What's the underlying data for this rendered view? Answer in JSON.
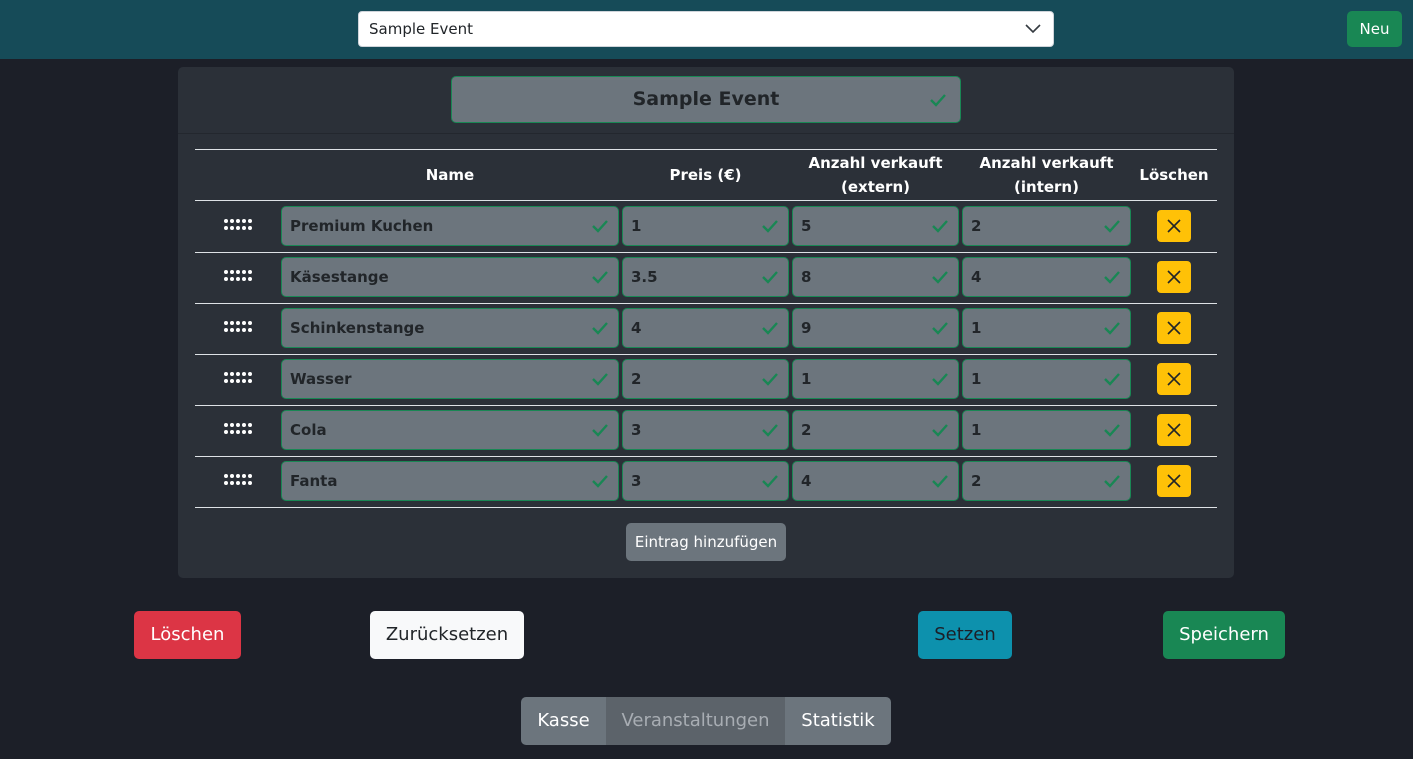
{
  "header": {
    "selected_event": "Sample Event",
    "new_button": "Neu"
  },
  "event": {
    "name": "Sample Event"
  },
  "table": {
    "columns": {
      "name": "Name",
      "price": "Preis (€)",
      "sold_external_1": "Anzahl verkauft",
      "sold_external_2": "(extern)",
      "sold_internal_1": "Anzahl verkauft",
      "sold_internal_2": "(intern)",
      "delete": "Löschen"
    },
    "rows": [
      {
        "name": "Premium Kuchen",
        "price": "1",
        "external": "5",
        "internal": "2"
      },
      {
        "name": "Käsestange",
        "price": "3.5",
        "external": "8",
        "internal": "4"
      },
      {
        "name": "Schinkenstange",
        "price": "4",
        "external": "9",
        "internal": "1"
      },
      {
        "name": "Wasser",
        "price": "2",
        "external": "1",
        "internal": "1"
      },
      {
        "name": "Cola",
        "price": "3",
        "external": "2",
        "internal": "1"
      },
      {
        "name": "Fanta",
        "price": "3",
        "external": "4",
        "internal": "2"
      }
    ],
    "add_entry": "Eintrag hinzufügen"
  },
  "actions": {
    "delete": "Löschen",
    "reset": "Zurücksetzen",
    "set": "Setzen",
    "save": "Speichern"
  },
  "nav": {
    "kasse": "Kasse",
    "events": "Veranstaltungen",
    "stats": "Statistik"
  },
  "colors": {
    "topbar": "#164b58",
    "background": "#1c1f28",
    "card": "#2b3038",
    "input": "#6c757d",
    "valid_border": "#198754",
    "warning": "#ffc107",
    "danger": "#dc3545",
    "info": "#0d91ad",
    "success": "#198754"
  },
  "icons": {
    "check": "check-icon",
    "grip": "grip-icon",
    "delete_row": "x-icon",
    "select": "chevron-down-icon"
  }
}
